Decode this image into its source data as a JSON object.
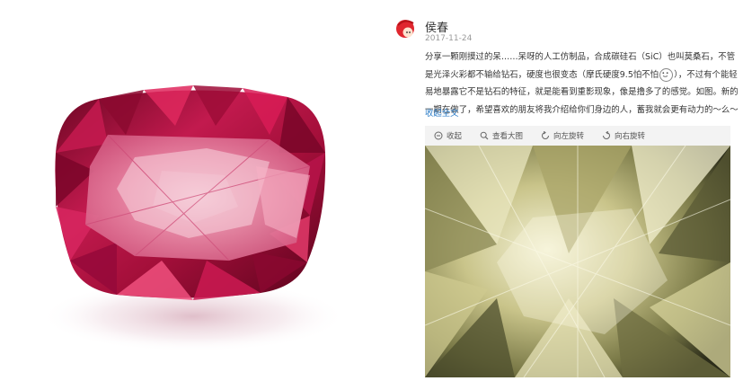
{
  "post": {
    "username": "侯春",
    "timestamp": "2017-11-24",
    "content_part1": "分享一颗刚摸过的呆……呆呀的人工仿制品，合成碳硅石（SiC）也叫莫桑石，不管是光泽火彩都不输给钻石，硬度也很变态（摩氏硬度9.5怕不怕",
    "content_part2": "），不过有个能轻易地暴露它不是钻石的特征，就是能看到重影现象，像是撸多了的感觉。如图。新的一期在做了，希望喜欢的朋友将我介绍给你们身边的人，蓄我就会更有动力的～么～",
    "expand_link": "收起全文",
    "toolbar": {
      "collapse": "收起",
      "view_large": "查看大图",
      "rotate_left": "向左旋转",
      "rotate_right": "向右旋转"
    }
  },
  "images": {
    "left": "red-gemstone",
    "right": "moissanite-closeup"
  }
}
